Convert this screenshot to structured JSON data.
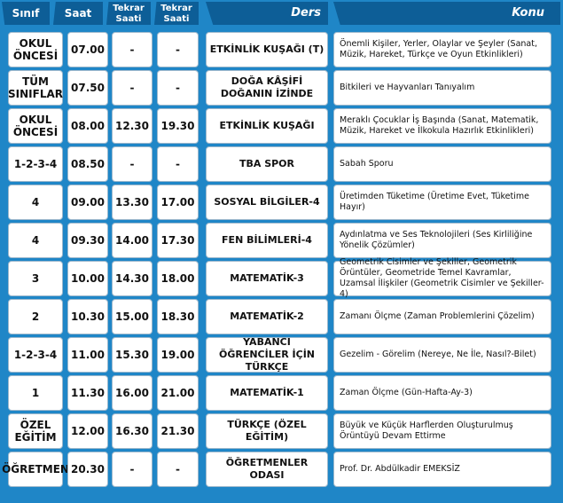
{
  "headers": {
    "sinif": "Sınıf",
    "saat": "Saat",
    "tekrar1": "Tekrar Saati",
    "tekrar2": "Tekrar Saati",
    "ders": "Ders",
    "konu": "Konu"
  },
  "rows": [
    {
      "sinif": "OKUL ÖNCESİ",
      "saat": "07.00",
      "tekrar1": "-",
      "tekrar2": "-",
      "ders": "ETKİNLİK KUŞAĞI (T)",
      "konu": "Önemli Kişiler, Yerler, Olaylar ve Şeyler (Sanat, Müzik, Hareket, Türkçe ve Oyun Etkinlikleri)"
    },
    {
      "sinif": "TÜM SINIFLAR",
      "saat": "07.50",
      "tekrar1": "-",
      "tekrar2": "-",
      "ders": "DOĞA KÂŞİFİ DOĞANIN İZİNDE",
      "konu": "Bitkileri ve Hayvanları Tanıyalım"
    },
    {
      "sinif": "OKUL ÖNCESİ",
      "saat": "08.00",
      "tekrar1": "12.30",
      "tekrar2": "19.30",
      "ders": "ETKİNLİK KUŞAĞI",
      "konu": "Meraklı Çocuklar İş Başında (Sanat, Matematik, Müzik, Hareket ve İlkokula Hazırlık Etkinlikleri)"
    },
    {
      "sinif": "1-2-3-4",
      "saat": "08.50",
      "tekrar1": "-",
      "tekrar2": "-",
      "ders": "TBA SPOR",
      "konu": "Sabah Sporu"
    },
    {
      "sinif": "4",
      "saat": "09.00",
      "tekrar1": "13.30",
      "tekrar2": "17.00",
      "ders": "SOSYAL BİLGİLER-4",
      "konu": "Üretimden Tüketime (Üretime Evet, Tüketime Hayır)"
    },
    {
      "sinif": "4",
      "saat": "09.30",
      "tekrar1": "14.00",
      "tekrar2": "17.30",
      "ders": "FEN BİLİMLERİ-4",
      "konu": "Aydınlatma ve Ses Teknolojileri (Ses Kirliliğine Yönelik Çözümler)"
    },
    {
      "sinif": "3",
      "saat": "10.00",
      "tekrar1": "14.30",
      "tekrar2": "18.00",
      "ders": "MATEMATİK-3",
      "konu": "Geometrik Cisimler ve Şekiller, Geometrik Örüntüler, Geometride Temel Kavramlar, Uzamsal İlişkiler (Geometrik Cisimler ve Şekiller-4)"
    },
    {
      "sinif": "2",
      "saat": "10.30",
      "tekrar1": "15.00",
      "tekrar2": "18.30",
      "ders": "MATEMATİK-2",
      "konu": "Zamanı Ölçme (Zaman Problemlerini Çözelim)"
    },
    {
      "sinif": "1-2-3-4",
      "saat": "11.00",
      "tekrar1": "15.30",
      "tekrar2": "19.00",
      "ders": "YABANCI ÖĞRENCİLER İÇİN TÜRKÇE",
      "konu": "Gezelim - Görelim (Nereye, Ne İle, Nasıl?-Bilet)"
    },
    {
      "sinif": "1",
      "saat": "11.30",
      "tekrar1": "16.00",
      "tekrar2": "21.00",
      "ders": "MATEMATİK-1",
      "konu": "Zaman Ölçme (Gün-Hafta-Ay-3)"
    },
    {
      "sinif": "ÖZEL EĞİTİM",
      "saat": "12.00",
      "tekrar1": "16.30",
      "tekrar2": "21.30",
      "ders": "TÜRKÇE (ÖZEL EĞİTİM)",
      "konu": "Büyük ve Küçük Harflerden Oluşturulmuş Örüntüyü Devam Ettirme"
    },
    {
      "sinif": "ÖĞRETMEN",
      "saat": "20.30",
      "tekrar1": "-",
      "tekrar2": "-",
      "ders": "ÖĞRETMENLER ODASI",
      "konu": "Prof. Dr. Abdülkadir EMEKSİZ"
    }
  ]
}
